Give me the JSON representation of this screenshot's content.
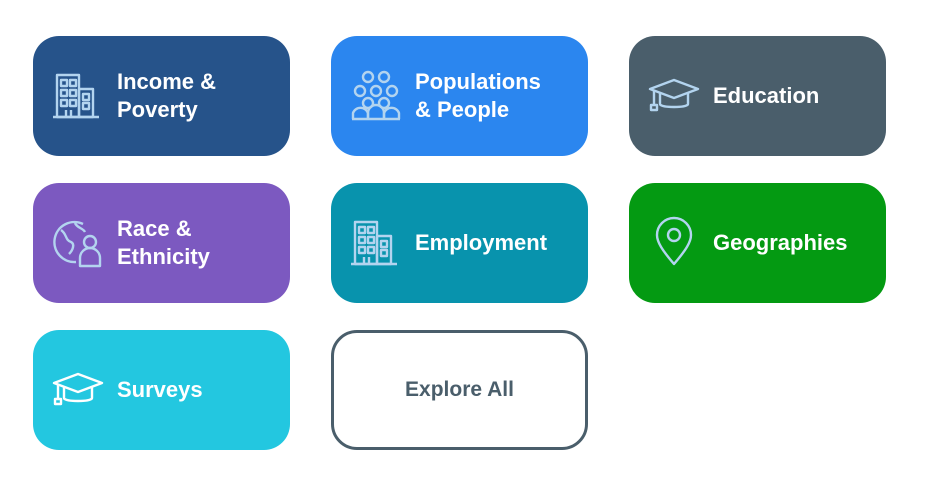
{
  "colors": {
    "icon_stroke": "#b3d4ef",
    "explore_border": "#4a5e6b"
  },
  "tiles": [
    {
      "label": "Income &\nPoverty",
      "icon": "building-icon",
      "color": "#26538a"
    },
    {
      "label": "Populations\n& People",
      "icon": "people-group-icon",
      "color": "#2b86ef"
    },
    {
      "label": "Education",
      "icon": "graduation-cap-icon",
      "color": "#4a5e6b"
    },
    {
      "label": "Race &\nEthnicity",
      "icon": "globe-person-icon",
      "color": "#7c59c0"
    },
    {
      "label": "Employment",
      "icon": "building-icon",
      "color": "#0893ad"
    },
    {
      "label": "Geographies",
      "icon": "map-pin-icon",
      "color": "#049a12"
    },
    {
      "label": "Surveys",
      "icon": "graduation-cap-icon",
      "color": "#23c7e0"
    }
  ],
  "explore": {
    "label": "Explore All"
  }
}
